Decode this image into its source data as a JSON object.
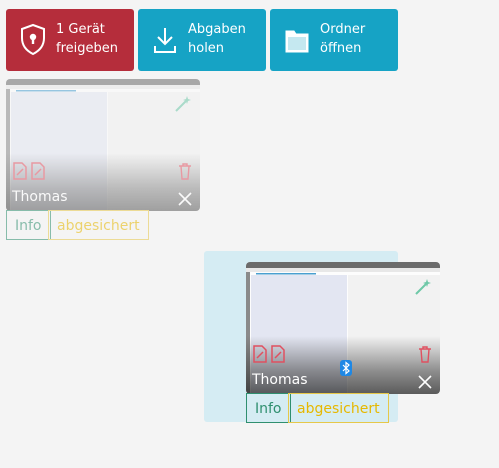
{
  "toolbar": {
    "share_label_line1": "1 Gerät",
    "share_label_line2": "freigeben",
    "collect_label_line1": "Abgaben",
    "collect_label_line2": "holen",
    "open_label_line1": "Ordner",
    "open_label_line2": "öffnen"
  },
  "devices": [
    {
      "name": "Thomas",
      "info_label": "Info",
      "status_label": "abgesichert",
      "bluetooth": false,
      "selected": false
    },
    {
      "name": "Thomas",
      "info_label": "Info",
      "status_label": "abgesichert",
      "bluetooth": true,
      "selected": true
    }
  ],
  "colors": {
    "share_button": "#b52d3b",
    "action_button": "#16a3c5",
    "info_tag": "#2f8f6f",
    "status_tag": "#e6b800",
    "selection": "#d5ecf3",
    "delete_icon": "#e05060",
    "magic_icon": "#6fc8a8"
  },
  "icons": [
    "shield-lock-icon",
    "download-icon",
    "folder-icon",
    "magic-wand-icon",
    "edit-file-icon",
    "trash-icon",
    "close-icon",
    "bluetooth-icon"
  ]
}
